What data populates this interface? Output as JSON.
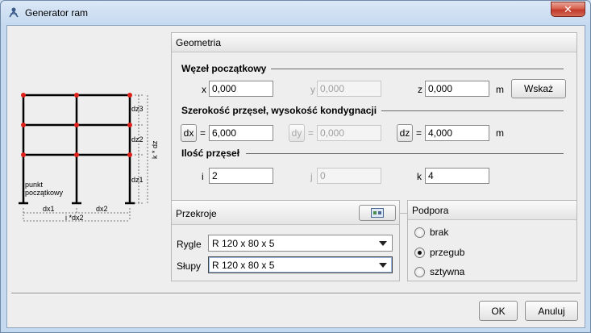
{
  "window": {
    "title": "Generator ram",
    "close_symbol": "✕"
  },
  "diagram": {
    "labels": {
      "dz3": "dz3",
      "dz2": "dz2",
      "dz1": "dz1",
      "kdz": "k * dz",
      "dx1": "dx1",
      "dx2": "dx2",
      "idx2": "i *dx2",
      "start1": "punkt",
      "start2": "początkowy"
    },
    "node_color": "#e0201a"
  },
  "geometria": {
    "title": "Geometria",
    "start_node": {
      "title": "Węzeł początkowy",
      "x_label": "x",
      "x_value": "0,000",
      "y_label": "y",
      "y_value": "0,000",
      "z_label": "z",
      "z_value": "0,000",
      "unit": "m",
      "pick_label": "Wskaż"
    },
    "spans": {
      "title": "Szerokość przęseł, wysokość kondygnacji",
      "dx_label": "dx",
      "dx_value": "6,000",
      "dy_label": "dy",
      "dy_value": "0,000",
      "dz_label": "dz",
      "dz_value": "4,000",
      "eq": "=",
      "unit": "m"
    },
    "count": {
      "title": "Ilość przęseł",
      "i_label": "i",
      "i_value": "2",
      "j_label": "j",
      "j_value": "0",
      "k_label": "k",
      "k_value": "4"
    }
  },
  "przekroje": {
    "title": "Przekroje",
    "rygle_label": "Rygle",
    "rygle_value": "R 120 x 80 x 5",
    "slupy_label": "Słupy",
    "slupy_value": "R 120 x 80 x 5"
  },
  "podpora": {
    "title": "Podpora",
    "options": [
      {
        "label": "brak",
        "selected": false
      },
      {
        "label": "przegub",
        "selected": true
      },
      {
        "label": "sztywna",
        "selected": false
      }
    ]
  },
  "footer": {
    "ok_label": "OK",
    "cancel_label": "Anuluj"
  }
}
